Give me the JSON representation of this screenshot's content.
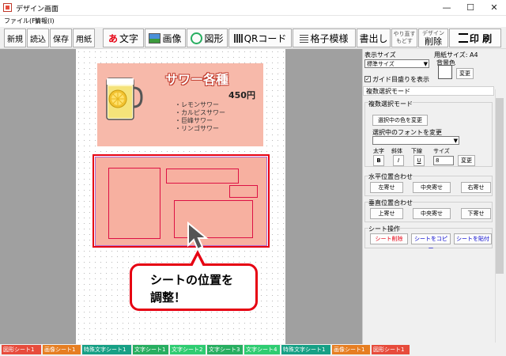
{
  "window": {
    "title": "デザイン画面",
    "minimize": "—",
    "maximize": "☐",
    "close": "✕"
  },
  "menubar": [
    "ファイル(F)",
    "情報(I)"
  ],
  "toolbar": {
    "new": "新規",
    "open": "読込",
    "save": "保存",
    "paper": "用紙",
    "text": "文字",
    "image": "画像",
    "shape": "図形",
    "qrcode": "QRコード",
    "grid": "格子模様",
    "heading": "書出し",
    "undo": "やり直す",
    "redo": "もどす",
    "design_small": "デザイン",
    "delete": "削除",
    "print": "印 刷",
    "text_icon": "あ"
  },
  "sheet1": {
    "title": "サワー各種",
    "price": "450円",
    "items": [
      "レモンサワー",
      "カルピスサワー",
      "巨峰サワー",
      "リンゴサワー"
    ]
  },
  "callout": {
    "line1": "シートの位置を",
    "line2": "調整！"
  },
  "panel": {
    "display_size_label": "表示サイズ",
    "display_size_value": "標準サイズ",
    "paper_size_label": "用紙サイズ:",
    "paper_size_value": "A4",
    "bg_color_label": "背景色",
    "change": "変更",
    "guide_checkbox": "ガイド目盛りを表示",
    "mode_box": "複数選択モード",
    "mode_group": "複数選択モード",
    "change_color_btn": "選択中の色を変更",
    "change_font_label": "選択中のフォントを変更",
    "bold_label": "太字",
    "italic_label": "斜体",
    "underline_label": "下線",
    "size_label": "サイズ",
    "bold": "B",
    "italic": "I",
    "underline": "U",
    "font_size": "8",
    "h_align_label": "水平位置合わせ",
    "left": "左寄せ",
    "center": "中央寄せ",
    "right": "右寄せ",
    "v_align_label": "垂直位置合わせ",
    "top": "上寄せ",
    "middle": "中央寄せ",
    "bottom": "下寄せ",
    "sheet_ops_label": "シート操作",
    "sheet_delete": "シート削除",
    "sheet_copy": "シートをコピー",
    "sheet_paste": "シートを貼付"
  },
  "tabs": [
    {
      "label": "図形シート1",
      "color": "#e74c3c"
    },
    {
      "label": "画像シート1",
      "color": "#e67e22"
    },
    {
      "label": "特殊文字シート1",
      "color": "#16a085"
    },
    {
      "label": "文字シート1",
      "color": "#27ae60"
    },
    {
      "label": "文字シート2",
      "color": "#2ecc71"
    },
    {
      "label": "文字シート3",
      "color": "#27ae60"
    },
    {
      "label": "文字シート4",
      "color": "#2ecc71"
    },
    {
      "label": "特殊文字シート1",
      "color": "#16a085"
    },
    {
      "label": "画像シート1",
      "color": "#e67e22"
    },
    {
      "label": "図形シート1",
      "color": "#e74c3c"
    }
  ]
}
